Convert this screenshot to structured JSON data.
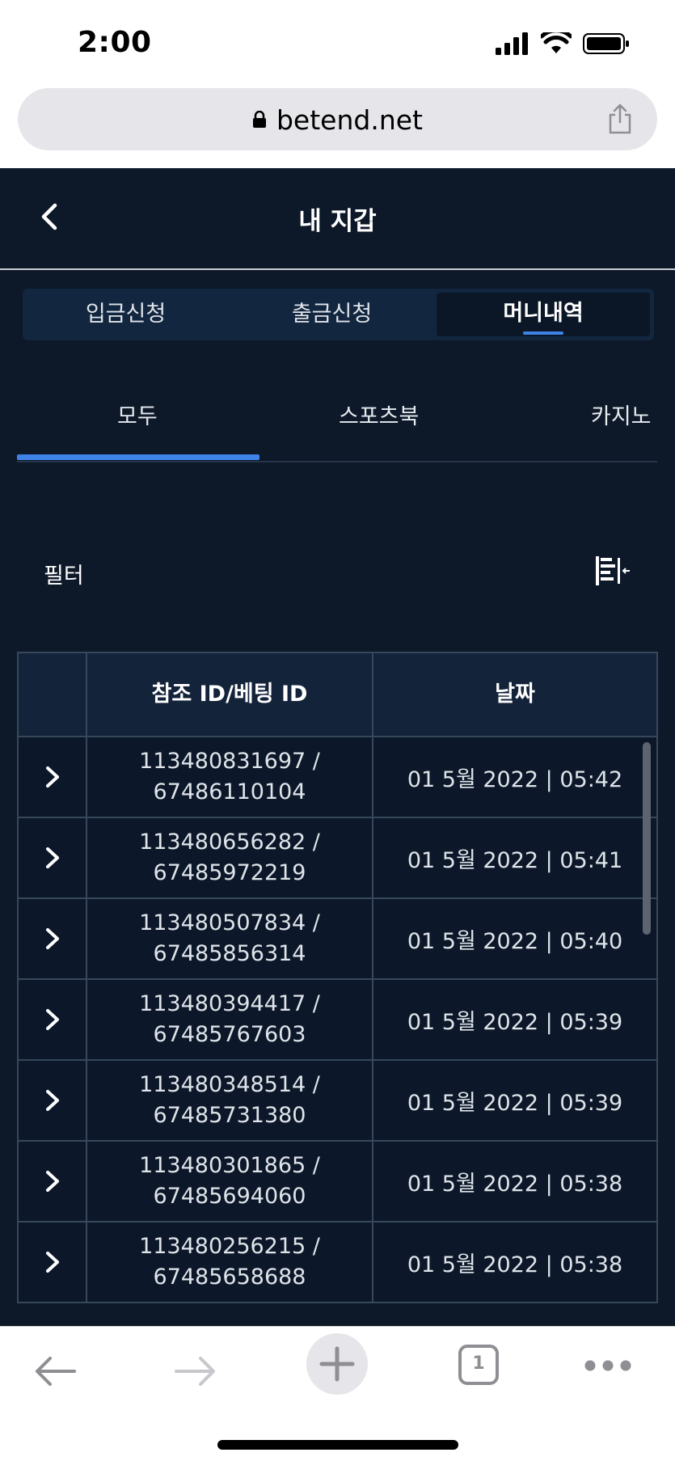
{
  "status_bar": {
    "time": "2:00"
  },
  "browser": {
    "url": "betend.net"
  },
  "header": {
    "title": "내 지갑"
  },
  "segments": [
    {
      "label": "입금신청",
      "active": false
    },
    {
      "label": "출금신청",
      "active": false
    },
    {
      "label": "머니내역",
      "active": true
    }
  ],
  "sub_tabs": [
    {
      "label": "모두",
      "active": true
    },
    {
      "label": "스포츠북",
      "active": false
    },
    {
      "label": "카지노",
      "active": false
    }
  ],
  "filter": {
    "label": "필터"
  },
  "table": {
    "headers": [
      "",
      "참조 ID/베팅 ID",
      "날짜"
    ],
    "rows": [
      {
        "ref_id": "113480831697 /",
        "bet_id": "67486110104",
        "date": "01 5월 2022 | 05:42"
      },
      {
        "ref_id": "113480656282 /",
        "bet_id": "67485972219",
        "date": "01 5월 2022 | 05:41"
      },
      {
        "ref_id": "113480507834 /",
        "bet_id": "67485856314",
        "date": "01 5월 2022 | 05:40"
      },
      {
        "ref_id": "113480394417 /",
        "bet_id": "67485767603",
        "date": "01 5월 2022 | 05:39"
      },
      {
        "ref_id": "113480348514 /",
        "bet_id": "67485731380",
        "date": "01 5월 2022 | 05:39"
      },
      {
        "ref_id": "113480301865 /",
        "bet_id": "67485694060",
        "date": "01 5월 2022 | 05:38"
      },
      {
        "ref_id": "113480256215 /",
        "bet_id": "67485658688",
        "date": "01 5월 2022 | 05:38"
      }
    ]
  },
  "toolbar": {
    "tab_count": "1"
  },
  "colors": {
    "app_bg": "#0d1828",
    "accent": "#3e83e8",
    "table_border": "#37475c"
  }
}
